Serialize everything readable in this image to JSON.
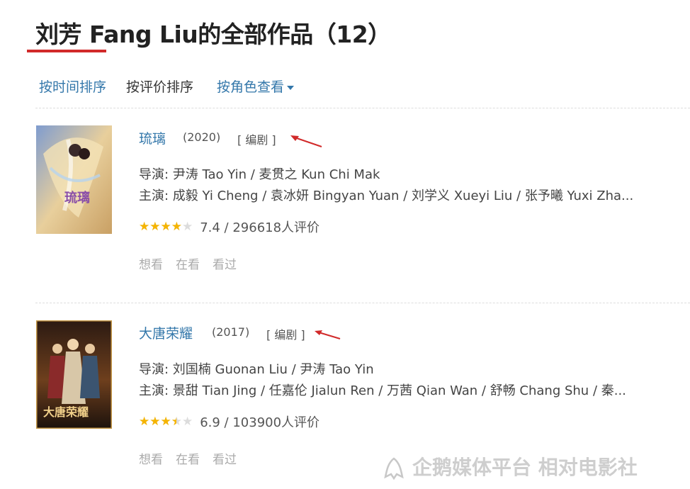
{
  "page": {
    "title": "刘芳 Fang Liu的全部作品（12）",
    "accent_color": "#d12a2a",
    "link_color": "#3377aa"
  },
  "sort_bar": {
    "by_time": "按时间排序",
    "by_rating": "按评价排序",
    "by_role": "按角色查看",
    "by_role_icon": "caret-down-icon"
  },
  "films": [
    {
      "title": "琉璃",
      "year": "(2020)",
      "role": "[ 编剧 ]",
      "director_line": "导演: 尹涛 Tao Yin / 麦贯之 Kun Chi Mak",
      "cast_line": "主演: 成毅 Yi Cheng / 袁冰妍 Bingyan Yuan / 刘学义 Xueyi Liu / 张予曦 Yuxi Zha...",
      "rating_fraction": 0.8,
      "rating_text": "7.4 / 296618人评价",
      "actions": [
        "想看",
        "在看",
        "看过"
      ],
      "poster_text": "琉璃",
      "poster_colors": [
        "#8fa7d4",
        "#e9c88c",
        "#caa063"
      ]
    },
    {
      "title": "大唐荣耀",
      "year": "(2017)",
      "role": "[ 编剧 ]",
      "director_line": "导演: 刘国楠 Guonan Liu / 尹涛 Tao Yin",
      "cast_line": "主演: 景甜 Tian Jing / 任嘉伦 Jialun Ren / 万茜 Qian Wan / 舒畅 Chang Shu / 秦...",
      "rating_fraction": 0.7,
      "rating_text": "6.9 / 103900人评价",
      "actions": [
        "想看",
        "在看",
        "看过"
      ],
      "poster_text": "大唐荣耀",
      "poster_colors": [
        "#2a1a12",
        "#7a4a22",
        "#c79a4a"
      ]
    }
  ],
  "watermark": {
    "text": "企鹅媒体平台 相对电影社",
    "icon": "penguin-logo-icon"
  }
}
